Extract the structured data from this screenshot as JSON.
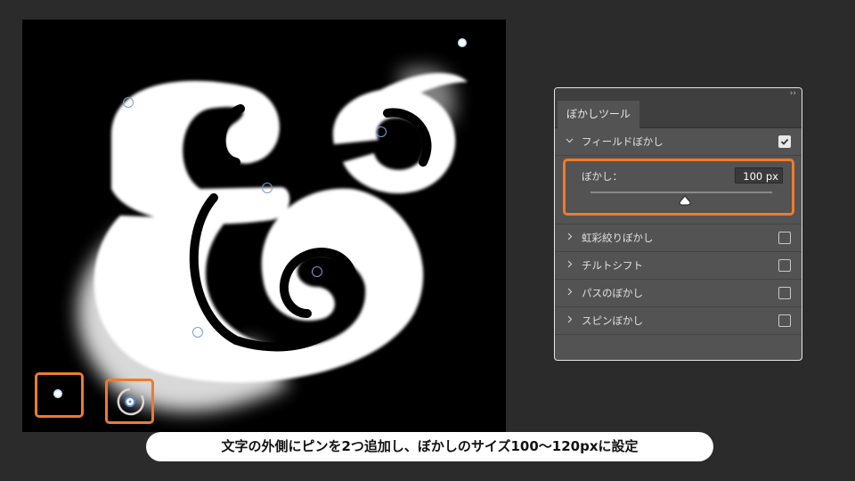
{
  "panel": {
    "tab_label": "ぼかしツール",
    "collapse_glyph": "››",
    "field_blur": {
      "label": "フィールドぼかし",
      "checked": true
    },
    "blur_control": {
      "label": "ぼかし：",
      "value": "100 px",
      "slider_fraction": 0.52
    },
    "items": [
      {
        "label": "虹彩絞りぼかし",
        "checked": false
      },
      {
        "label": "チルトシフト",
        "checked": false
      },
      {
        "label": "パスのぼかし",
        "checked": false
      },
      {
        "label": "スピンぼかし",
        "checked": false
      }
    ]
  },
  "caption": {
    "text": "文字の外側にピンを2つ追加し、ぼかしのサイズ100〜120pxに設定"
  },
  "colors": {
    "accent_orange": "#f07a2c",
    "panel_bg": "#535353",
    "app_bg": "#2b2b2b"
  },
  "icons": {
    "expanded": "chevron-down-icon",
    "collapsed": "chevron-right-icon",
    "check": "check-icon"
  }
}
